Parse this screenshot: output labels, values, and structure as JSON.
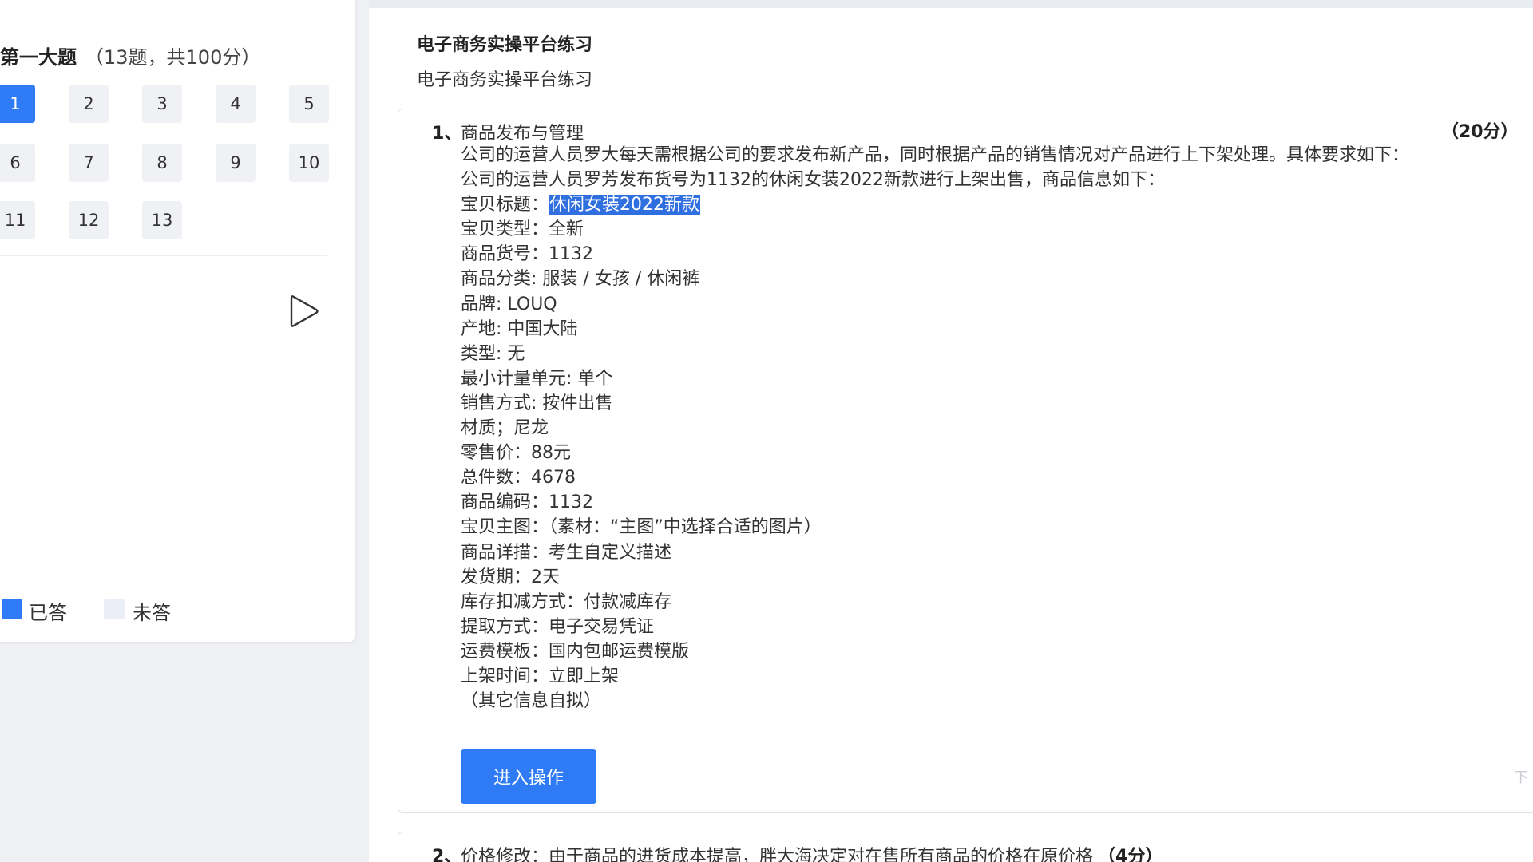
{
  "sidebar": {
    "section_title": "第一大题",
    "section_sub": "（13题，共100分）",
    "questions": [
      "1",
      "2",
      "3",
      "4",
      "5",
      "6",
      "7",
      "8",
      "9",
      "10",
      "11",
      "12",
      "13"
    ],
    "active_question": "1",
    "legend": {
      "answered_label": "已答",
      "unanswered_label": "未答",
      "answered_color": "#2f7bf5",
      "unanswered_color": "#ebedf7"
    },
    "play_icon": "play-triangle-icon"
  },
  "main": {
    "title": "电子商务实操平台练习",
    "subtitle": "电子商务实操平台练习",
    "question1": {
      "number": "1、",
      "title": "商品发布与管理",
      "score": "（20分）",
      "intro": "公司的运营人员罗大每天需根据公司的要求发布新产品，同时根据产品的销售情况对产品进行上下架处理。具体要求如下：",
      "line1": "公司的运营人员罗芳发布货号为1132的休闲女装2022新款进行上架出售，商品信息如下：",
      "title_label": "宝贝标题：",
      "title_value": "休闲女装2022新款",
      "lines": [
        "宝贝类型：全新",
        "商品货号：1132",
        "商品分类: 服装 / 女孩 / 休闲裤",
        "品牌: LOUQ",
        "产地: 中国大陆",
        "类型: 无",
        "最小计量单元: 单个",
        "销售方式: 按件出售",
        "材质；尼龙",
        "零售价：88元",
        "总件数：4678",
        "商品编码：1132",
        "宝贝主图：（素材：“主图”中选择合适的图片）",
        "商品详描：考生自定义描述",
        "发货期：2天",
        "库存扣减方式：付款减库存",
        "提取方式：电子交易凭证",
        "运费模板：国内包邮运费模版",
        "上架时间：立即上架",
        "（其它信息自拟）"
      ],
      "button_label": "进入操作"
    },
    "question2": {
      "number": "2、",
      "text": "价格修改：由于商品的进货成本提高，胖大海决定对在售所有商品的价格在原价格",
      "score": "（4分）"
    },
    "scroll_hint": "下",
    "accent_color": "#2f7bf5"
  }
}
